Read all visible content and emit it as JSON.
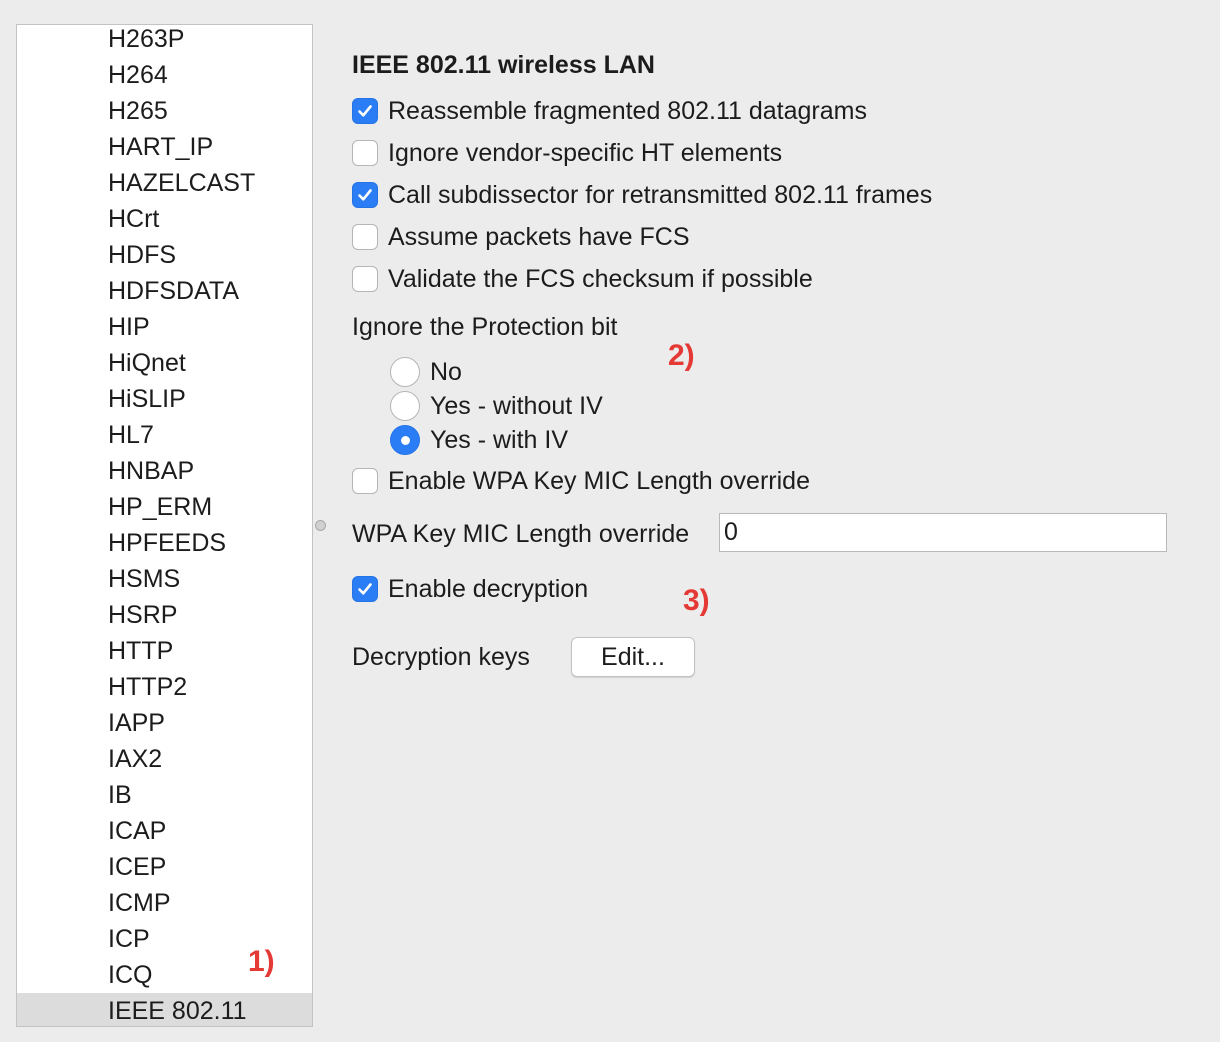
{
  "protocol_list": {
    "items": [
      "H263P",
      "H264",
      "H265",
      "HART_IP",
      "HAZELCAST",
      "HCrt",
      "HDFS",
      "HDFSDATA",
      "HIP",
      "HiQnet",
      "HiSLIP",
      "HL7",
      "HNBAP",
      "HP_ERM",
      "HPFEEDS",
      "HSMS",
      "HSRP",
      "HTTP",
      "HTTP2",
      "IAPP",
      "IAX2",
      "IB",
      "ICAP",
      "ICEP",
      "ICMP",
      "ICP",
      "ICQ",
      "IEEE 802.11"
    ],
    "selected": "IEEE 802.11"
  },
  "annotations": {
    "marker_1": "1)",
    "marker_2": "2)",
    "marker_3": "3)",
    "color": "#e53935"
  },
  "preferences": {
    "title": "IEEE 802.11 wireless LAN",
    "checkboxes": [
      {
        "label": "Reassemble fragmented 802.11 datagrams",
        "checked": true
      },
      {
        "label": "Ignore vendor-specific HT elements",
        "checked": false
      },
      {
        "label": "Call subdissector for retransmitted 802.11 frames",
        "checked": true
      },
      {
        "label": "Assume packets have FCS",
        "checked": false
      },
      {
        "label": "Validate the FCS checksum if possible",
        "checked": false
      }
    ],
    "protection_bit": {
      "label": "Ignore the Protection bit",
      "options": [
        {
          "label": "No",
          "selected": false
        },
        {
          "label": "Yes - without IV",
          "selected": false
        },
        {
          "label": "Yes - with IV",
          "selected": true
        }
      ]
    },
    "wpa_override_check": {
      "label": "Enable WPA Key MIC Length override",
      "checked": false
    },
    "wpa_override_field": {
      "label": "WPA Key MIC Length override",
      "value": "0"
    },
    "decryption_check": {
      "label": "Enable decryption",
      "checked": true
    },
    "decryption_keys": {
      "label": "Decryption keys",
      "button_label": "Edit..."
    }
  },
  "colors": {
    "accent": "#2b7df6",
    "background": "#ececec",
    "selected_row": "#dcdcdc"
  }
}
